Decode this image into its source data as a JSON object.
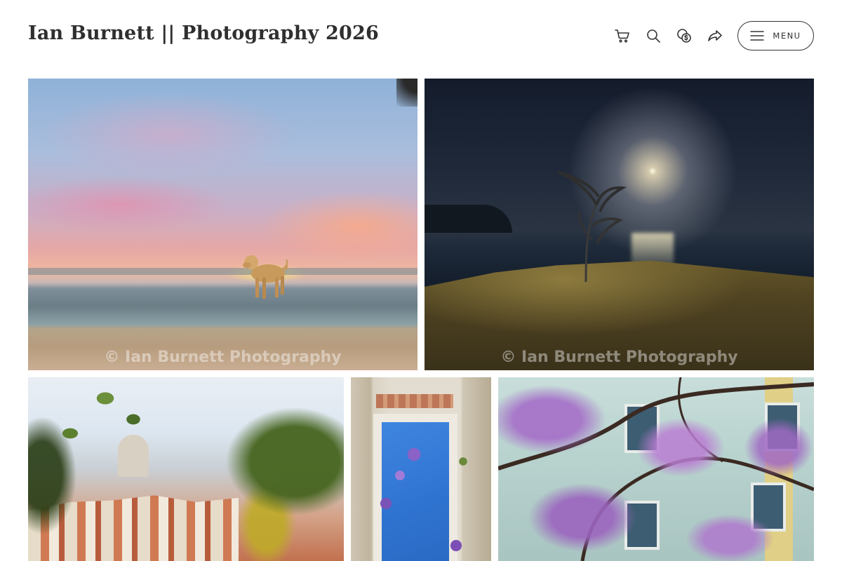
{
  "header": {
    "site_title": "Ian Burnett || Photography 2026",
    "icons": [
      "cart-icon",
      "search-icon",
      "currency-icon",
      "share-icon"
    ],
    "menu_label": "MENU"
  },
  "gallery": {
    "photos": [
      {
        "subject": "Golden retriever on a beach at sunset",
        "watermark": "© Ian Burnett Photography"
      },
      {
        "subject": "Moonlit sea with sculpture on rocks",
        "watermark": "© Ian Burnett Photography"
      },
      {
        "subject": "Lisbon rooftops and dome seen through leaves",
        "watermark": ""
      },
      {
        "subject": "Stone window frame with jacaranda and blue sky",
        "watermark": ""
      },
      {
        "subject": "Jacaranda tree in bloom in front of a building",
        "watermark": ""
      }
    ]
  },
  "colors": {
    "text": "#2f2f2f",
    "background": "#ffffff",
    "menu_border": "#333333"
  }
}
